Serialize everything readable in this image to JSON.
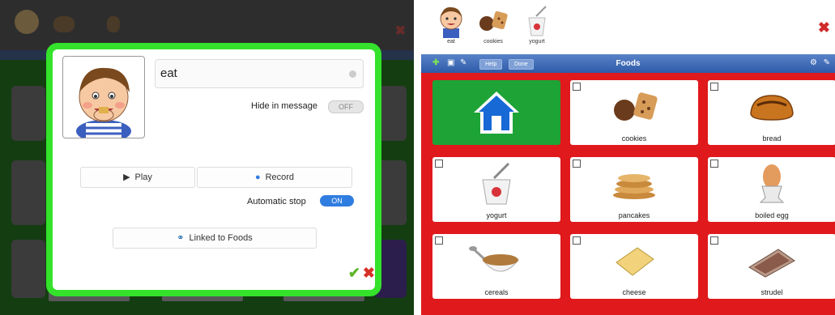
{
  "left_panel": {
    "dialog": {
      "label_value": "eat",
      "hide_in_message_label": "Hide in message",
      "hide_in_message_state": "OFF",
      "play_label": "Play",
      "record_label": "Record",
      "automatic_stop_label": "Automatic stop",
      "automatic_stop_state": "ON",
      "linked_label": "Linked to Foods"
    }
  },
  "right_panel": {
    "message_bar": [
      {
        "caption": "eat"
      },
      {
        "caption": "cookies"
      },
      {
        "caption": "yogurt"
      }
    ],
    "toolbar": {
      "title": "Foods",
      "button_1": "Help",
      "button_2": "Done"
    },
    "grid": [
      {
        "label": ""
      },
      {
        "label": "cookies"
      },
      {
        "label": "bread"
      },
      {
        "label": "yogurt"
      },
      {
        "label": "pancakes"
      },
      {
        "label": "boiled egg"
      },
      {
        "label": "cereals"
      },
      {
        "label": "cheese"
      },
      {
        "label": "strudel"
      }
    ]
  },
  "colors": {
    "dialog_border": "#34e22b",
    "board_background": "#e0191c",
    "home_cell": "#1ea336",
    "toolbar": "#2e5aa8",
    "accept": "#5fb62a",
    "cancel": "#d63128"
  },
  "icons": [
    "boy-eating-icon",
    "cookies-icon",
    "yogurt-icon",
    "play-icon",
    "microphone-icon",
    "link-icon",
    "checkmark-icon",
    "close-icon",
    "home-icon",
    "bread-icon",
    "pancakes-icon",
    "boiled-egg-icon",
    "cereals-icon",
    "cheese-icon",
    "strudel-icon",
    "add-icon",
    "settings-icon"
  ]
}
